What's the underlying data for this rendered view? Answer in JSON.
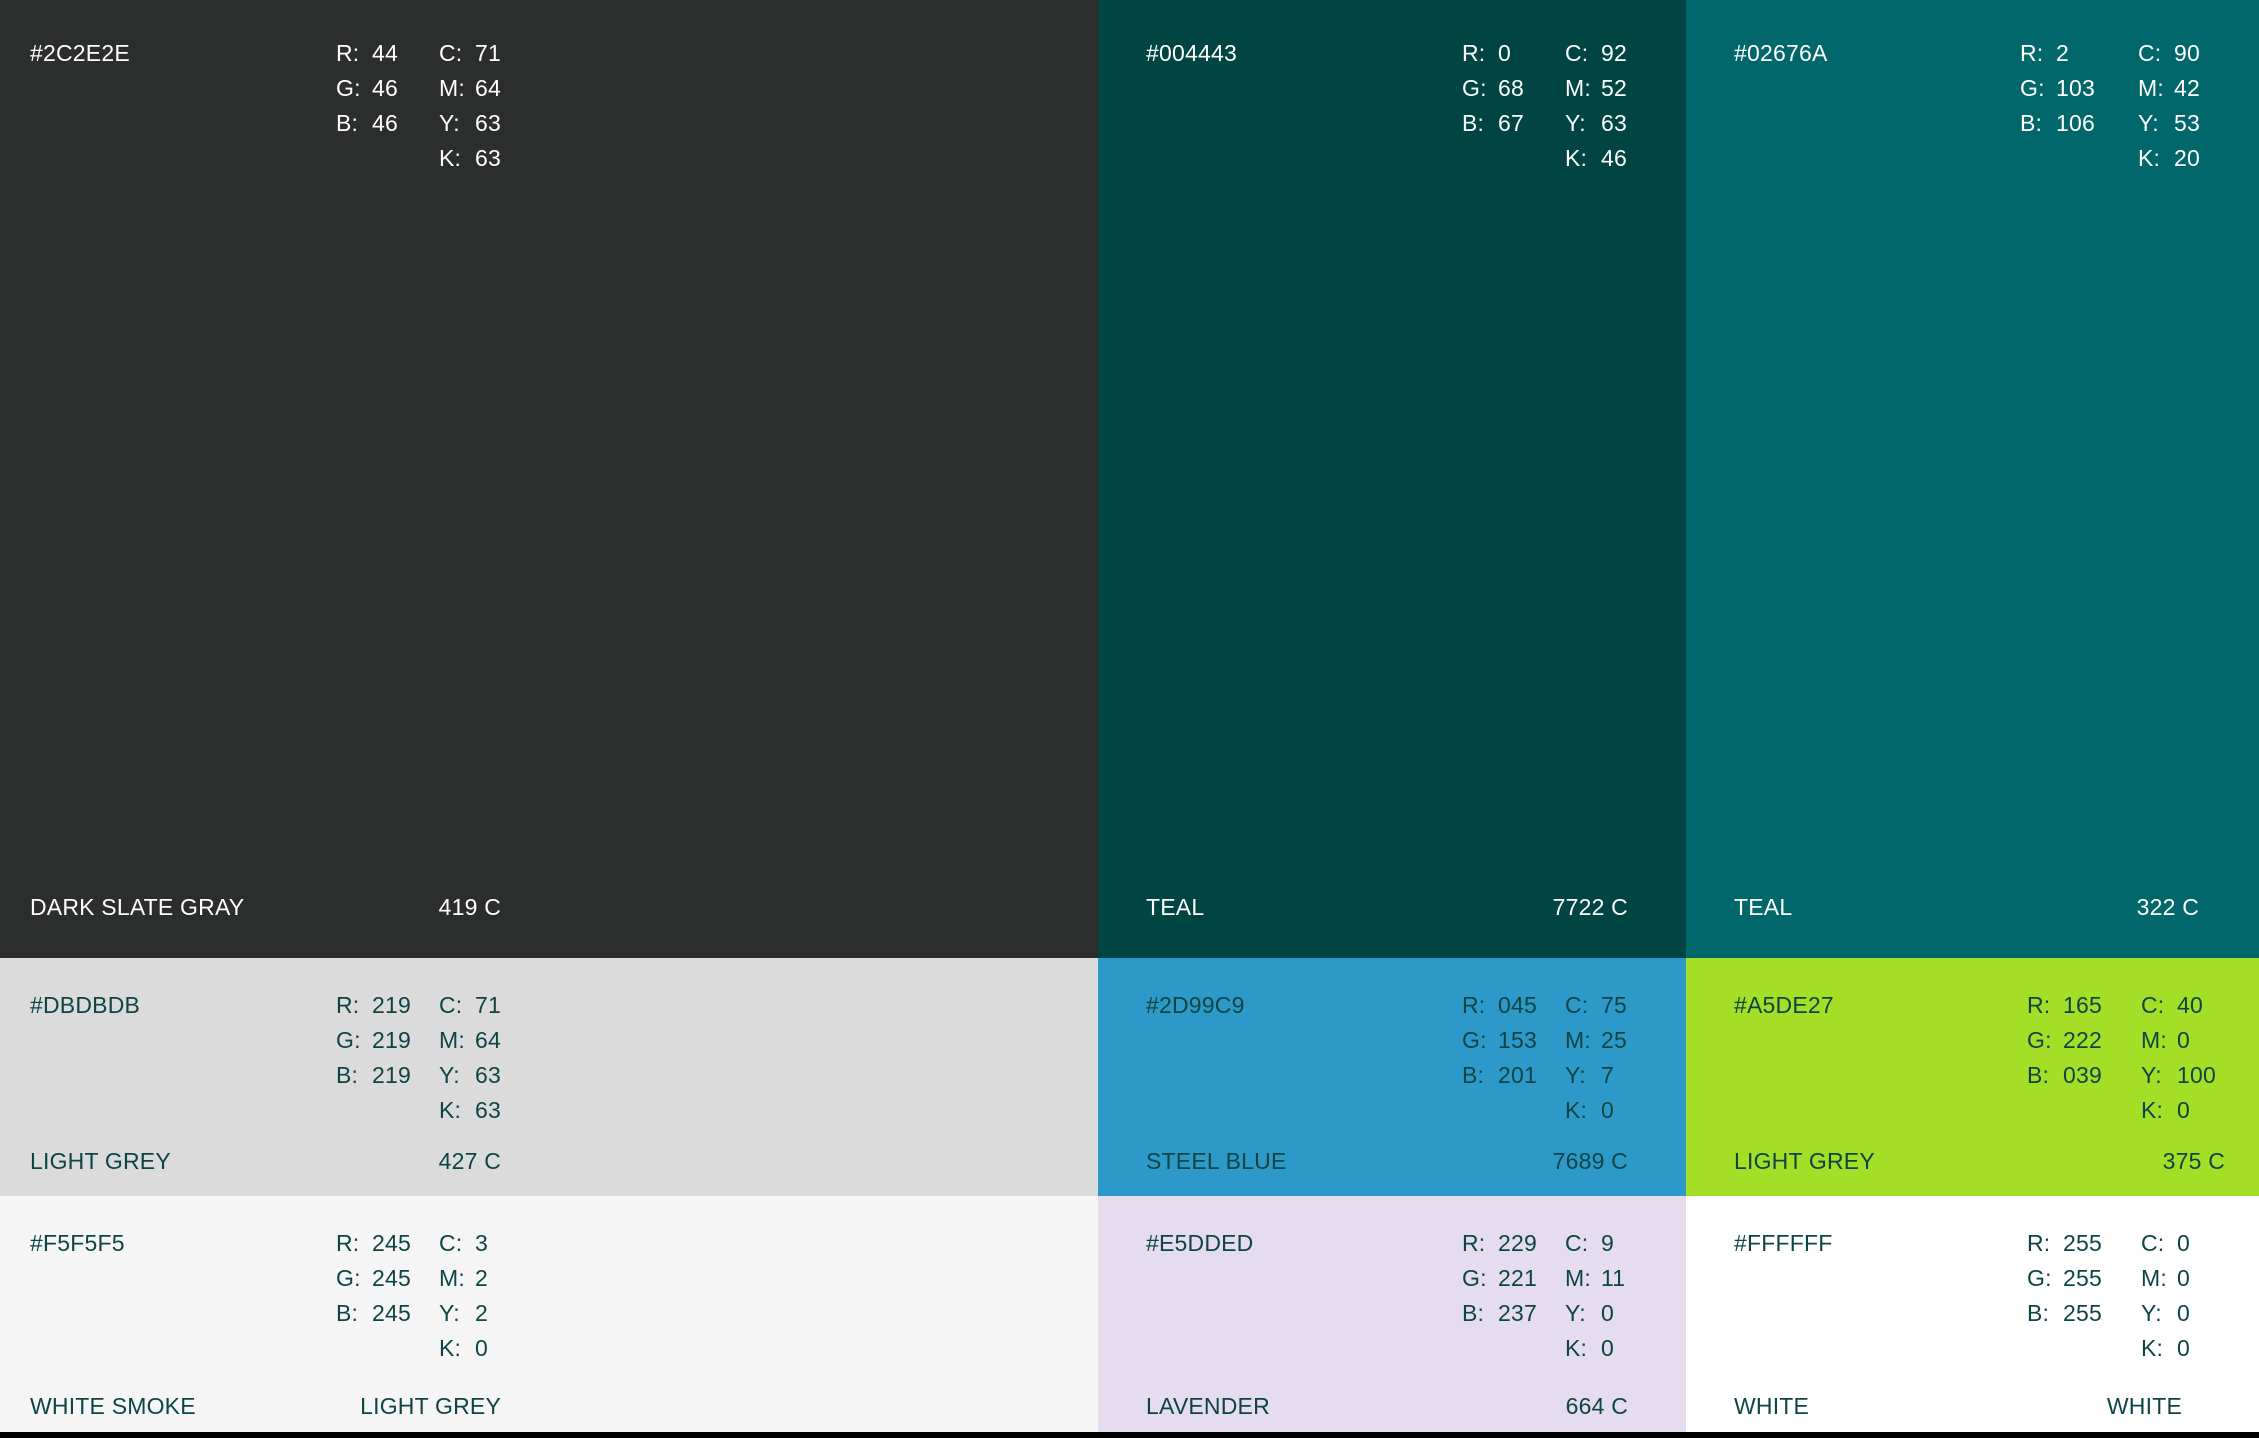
{
  "swatches": [
    {
      "hex": "#2C2E2E",
      "name": "DARK SLATE GRAY",
      "code": "419 C",
      "bg": "#2C2E2E",
      "fg": "#FFFFFF",
      "r": "44",
      "g": "46",
      "b": "46",
      "c": "71",
      "m": "64",
      "y": "63",
      "k": "63"
    },
    {
      "hex": "#004443",
      "name": "TEAL",
      "code": "7722 C",
      "bg": "#004443",
      "fg": "#FFFFFF",
      "r": "0",
      "g": "68",
      "b": "67",
      "c": "92",
      "m": "52",
      "y": "63",
      "k": "46"
    },
    {
      "hex": "#02676A",
      "name": "TEAL",
      "code": "322 C",
      "bg": "#02676A",
      "fg": "#FFFFFF",
      "r": "2",
      "g": "103",
      "b": "106",
      "c": "90",
      "m": "42",
      "y": "53",
      "k": "20"
    },
    {
      "hex": "#DBDBDB",
      "name": "LIGHT GREY",
      "code": "427 C",
      "bg": "#DBDBDB",
      "fg": "#0F4444",
      "r": "219",
      "g": "219",
      "b": "219",
      "c": "71",
      "m": "64",
      "y": "63",
      "k": "63"
    },
    {
      "hex": "#2D99C9",
      "name": "STEEL BLUE",
      "code": "7689 C",
      "bg": "#2D99C9",
      "fg": "#0F4444",
      "r": "045",
      "g": "153",
      "b": "201",
      "c": "75",
      "m": "25",
      "y": "7",
      "k": "0"
    },
    {
      "hex": "#A5DE27",
      "name": "LIGHT GREY",
      "code": "375 C",
      "bg": "#A5DE27",
      "fg": "#0F4444",
      "r": "165",
      "g": "222",
      "b": "039",
      "c": "40",
      "m": "0",
      "y": "100",
      "k": "0"
    },
    {
      "hex": "#F5F5F5",
      "name": "WHITE SMOKE",
      "code": "LIGHT GREY",
      "bg": "#F5F5F5",
      "fg": "#0F4444",
      "r": "245",
      "g": "245",
      "b": "245",
      "c": "3",
      "m": "2",
      "y": "2",
      "k": "0"
    },
    {
      "hex": "#E5DDED",
      "name": "LAVENDER",
      "code": "664 C",
      "bg": "#E5DDED",
      "fg": "#0F4444",
      "r": "229",
      "g": "221",
      "b": "237",
      "c": "9",
      "m": "11",
      "y": "0",
      "k": "0"
    },
    {
      "hex": "#FFFFFF",
      "name": "WHITE",
      "code": "WHITE",
      "bg": "#FFFFFF",
      "fg": "#0F4444",
      "r": "255",
      "g": "255",
      "b": "255",
      "c": "0",
      "m": "0",
      "y": "0",
      "k": "0"
    }
  ]
}
